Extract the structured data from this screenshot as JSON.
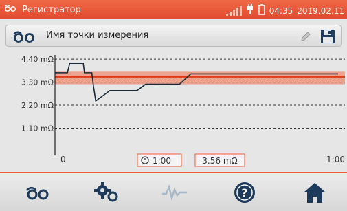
{
  "statusbar": {
    "app_title": "Регистратор",
    "time": "04:35",
    "date": "2019.02.11",
    "icons": [
      "app-logo-icon",
      "signal-icon",
      "plug-icon",
      "battery-icon"
    ]
  },
  "titlebar": {
    "title": "Имя точки измерения",
    "icons": [
      "measurement-point-icon",
      "edit-pencil-icon",
      "save-floppy-icon"
    ]
  },
  "chart_data": {
    "type": "line",
    "x": [
      0,
      0.1,
      0.22,
      0.26,
      0.5,
      0.52,
      0.65,
      0.68,
      0.72,
      0.97,
      1.0,
      1.45,
      1.5,
      1.6,
      2.2,
      2.4,
      4.0,
      5.0
    ],
    "y": [
      3.75,
      3.75,
      3.75,
      4.2,
      4.2,
      3.75,
      3.75,
      3.1,
      2.4,
      2.9,
      2.9,
      2.9,
      3.0,
      3.2,
      3.2,
      3.7,
      3.7,
      3.7
    ],
    "x_display_tick_labels": [
      "0",
      "1:00"
    ],
    "y_tick_labels": [
      "4.40 mΩ",
      "3.30 mΩ",
      "2.20 mΩ",
      "1.10 mΩ"
    ],
    "y_ticks": [
      4.4,
      3.3,
      2.2,
      1.1
    ],
    "ylim": [
      0,
      4.6
    ],
    "xlim": [
      0,
      5
    ],
    "reference_band": {
      "low": 3.2,
      "high": 3.8,
      "color": "#f06a47"
    },
    "reference_line": 3.56,
    "grid": "horizontal dashed",
    "cursor_time": "1:00",
    "cursor_value": "3.56 mΩ"
  },
  "nav": {
    "items": [
      {
        "name": "measurement-points-icon"
      },
      {
        "name": "settings-gears-icon"
      },
      {
        "name": "waveform-icon"
      },
      {
        "name": "help-icon"
      },
      {
        "name": "home-icon"
      }
    ]
  },
  "colors": {
    "accent": "#f05a3a",
    "line": "#1a2a3a",
    "panel": "#e6e6e6"
  }
}
